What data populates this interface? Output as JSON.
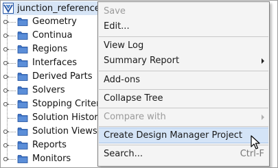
{
  "tree": {
    "root_label": "junction_reference",
    "items": [
      {
        "label": "Geometry",
        "expandable": true
      },
      {
        "label": "Continua",
        "expandable": true
      },
      {
        "label": "Regions",
        "expandable": true
      },
      {
        "label": "Interfaces",
        "expandable": true
      },
      {
        "label": "Derived Parts",
        "expandable": true
      },
      {
        "label": "Solvers",
        "expandable": true
      },
      {
        "label": "Stopping Criteria",
        "expandable": true
      },
      {
        "label": "Solution Histories",
        "expandable": false
      },
      {
        "label": "Solution Views",
        "expandable": true
      },
      {
        "label": "Reports",
        "expandable": true
      },
      {
        "label": "Monitors",
        "expandable": true
      }
    ]
  },
  "menu": {
    "save": "Save",
    "edit": "Edit...",
    "view_log": "View Log",
    "summary_report": "Summary Report",
    "add_ons": "Add-ons",
    "collapse_tree": "Collapse Tree",
    "compare_with": "Compare with",
    "create_dm_project": "Create Design Manager Project",
    "search": "Search...",
    "search_shortcut": "Ctrl-F"
  },
  "colors": {
    "folder": "#3f74c6",
    "highlight": "#d4e4f7",
    "menu_bg": "#f4f4f4",
    "selection": "#d7e5f6"
  }
}
